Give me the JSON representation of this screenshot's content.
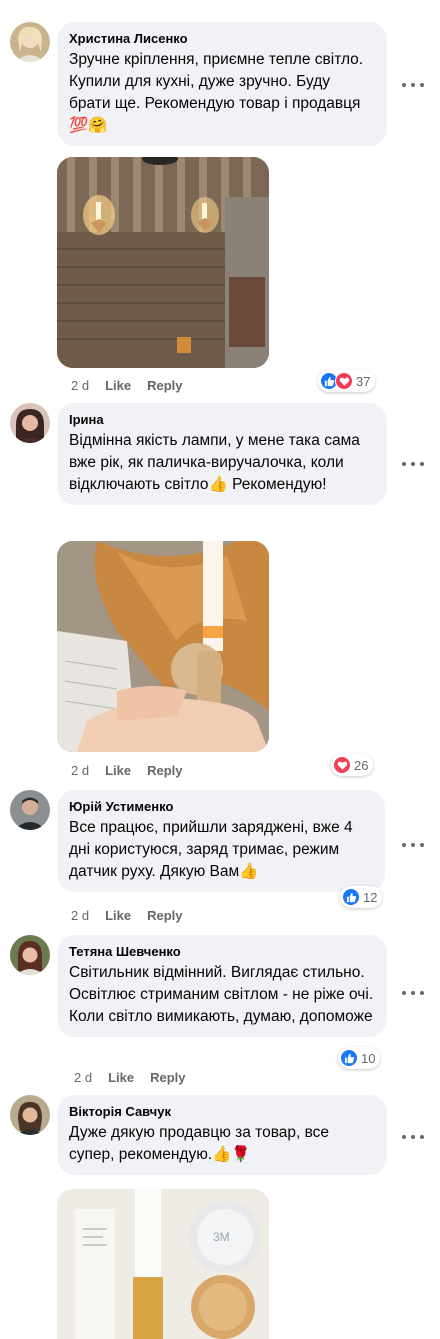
{
  "colors": {
    "bubble": "#f0f2f5",
    "like_blue": "#1877f2",
    "love_red": "#f33e58",
    "meta_gray": "#65676b"
  },
  "comments": [
    {
      "author": "Христина Лисенко",
      "text": "Зручне кріплення, приємне тепле світло. Купили для кухні, дуже зручно. Буду брати ще. Рекомендую товар і продавця 💯🤗",
      "time": "2 d",
      "like_label": "Like",
      "reply_label": "Reply",
      "reactions": [
        "like-icon",
        "love-icon"
      ],
      "reaction_count": "37"
    },
    {
      "author": "Ірина",
      "text": "Відмінна якість лампи, у мене така сама вже рік, як паличка-виручалочка, коли відключають світло👍 Рекомендую!",
      "time": "2 d",
      "like_label": "Like",
      "reply_label": "Reply",
      "reactions": [
        "love-icon"
      ],
      "reaction_count": "26"
    },
    {
      "author": "Юрій Устименко",
      "text": "Все працює, прийшли заряджені, вже 4 дні користуюся, заряд тримає, режим датчик руху. Дякую Вам👍",
      "time": "2 d",
      "like_label": "Like",
      "reply_label": "Reply",
      "reactions": [
        "like-icon"
      ],
      "reaction_count": "12"
    },
    {
      "author": "Тетяна Шевченко",
      "text": "Світильник відмінний. Виглядає стильно. Освітлює стриманим світлом - не ріже очі. Коли світло вимикають, думаю, допоможе",
      "time": "2 d",
      "like_label": "Like",
      "reply_label": "Reply",
      "reactions": [
        "like-icon"
      ],
      "reaction_count": "10"
    },
    {
      "author": "Вікторія Савчук",
      "text": "Дуже дякую продавцю за товар, все супер, рекомендую.👍🌹"
    }
  ]
}
